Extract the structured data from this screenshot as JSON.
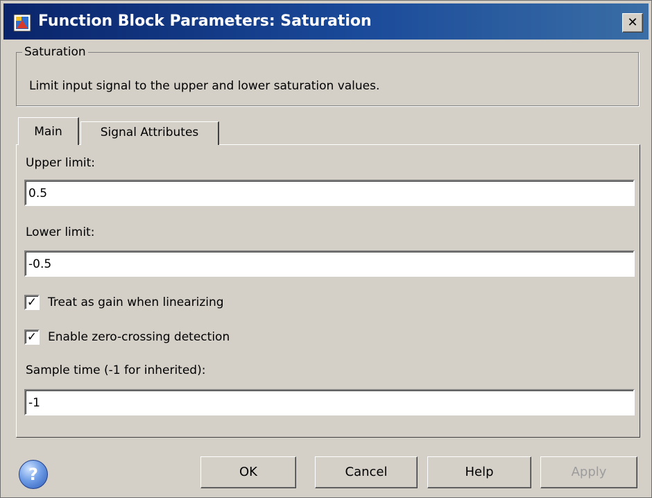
{
  "window": {
    "title": "Function Block Parameters: Saturation",
    "close_label": "✕"
  },
  "group": {
    "legend": "Saturation",
    "description": "Limit input signal to the upper and lower saturation values."
  },
  "tabs": [
    {
      "label": "Main",
      "active": true
    },
    {
      "label": "Signal Attributes",
      "active": false
    }
  ],
  "params": {
    "upper_limit": {
      "label": "Upper limit:",
      "value": "0.5"
    },
    "lower_limit": {
      "label": "Lower limit:",
      "value": "-0.5"
    },
    "treat_as_gain": {
      "label": "Treat as gain when linearizing",
      "checked": true,
      "mark": "✓"
    },
    "zero_crossing": {
      "label": "Enable zero-crossing detection",
      "checked": true,
      "mark": "✓"
    },
    "sample_time": {
      "label": "Sample time (-1 for inherited):",
      "value": "-1"
    }
  },
  "buttons": {
    "ok": "OK",
    "cancel": "Cancel",
    "help": "Help",
    "apply": "Apply"
  },
  "help_icon": {
    "glyph": "?"
  },
  "colors": {
    "title_bar": "#0a246a",
    "dialog_bg": "#d4d0c8",
    "disabled_text": "#9c9c9c"
  }
}
